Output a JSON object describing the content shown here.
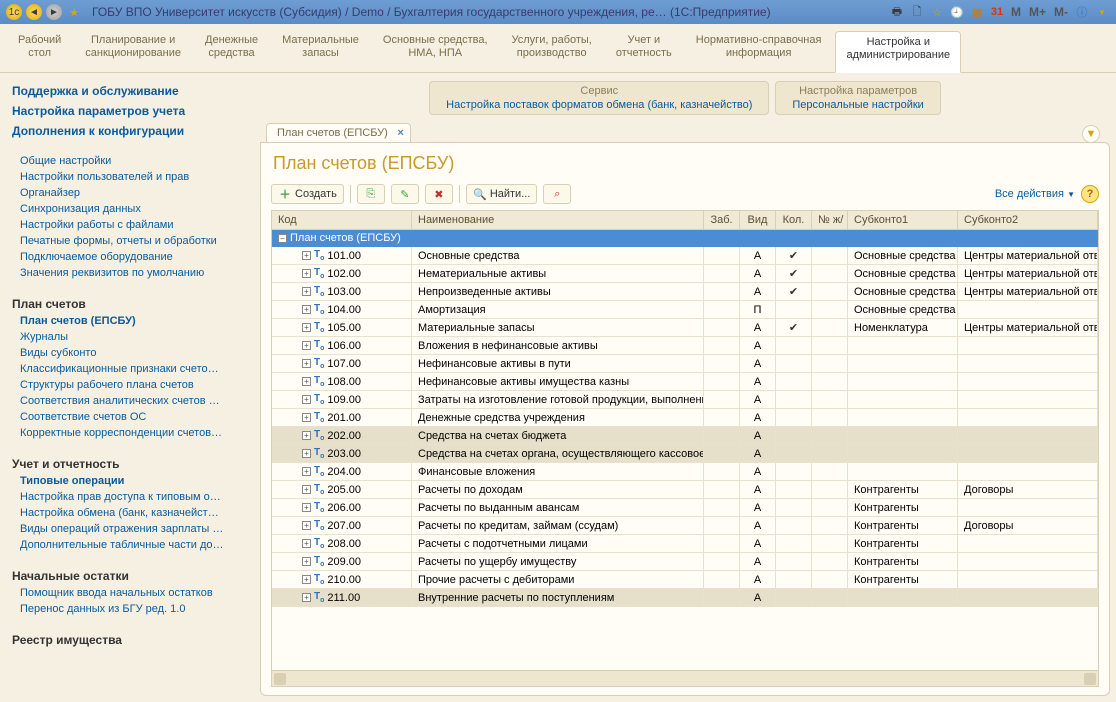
{
  "titlebar": {
    "title": "ГОБУ ВПО Университет искусств (Субсидия) / Demo / Бухгалтерия государственного учреждения, ре…   (1С:Предприятие)",
    "m_buttons": [
      "М",
      "М+",
      "М-"
    ]
  },
  "topnav": [
    {
      "l1": "Рабочий",
      "l2": "стол"
    },
    {
      "l1": "Планирование и",
      "l2": "санкционирование"
    },
    {
      "l1": "Денежные",
      "l2": "средства"
    },
    {
      "l1": "Материальные",
      "l2": "запасы"
    },
    {
      "l1": "Основные средства,",
      "l2": "НМА, НПА"
    },
    {
      "l1": "Услуги, работы,",
      "l2": "производство"
    },
    {
      "l1": "Учет и",
      "l2": "отчетность"
    },
    {
      "l1": "Нормативно-справочная",
      "l2": "информация"
    },
    {
      "l1": "Настройка и",
      "l2": "администрирование",
      "active": true
    }
  ],
  "sidebar": {
    "top": [
      "Поддержка и обслуживание",
      "Настройка параметров учета",
      "Дополнения к конфигурации"
    ],
    "general": [
      "Общие настройки",
      "Настройки пользователей и прав",
      "Органайзер",
      "Синхронизация данных",
      "Настройки работы с файлами",
      "Печатные формы, отчеты и обработки",
      "Подключаемое оборудование",
      "Значения реквизитов по умолчанию"
    ],
    "sec_plan": "План счетов",
    "plan": [
      "План счетов (ЕПСБУ)",
      "Журналы",
      "Виды субконто",
      "Классификационные признаки счето…",
      "Структуры рабочего плана счетов",
      "Соответствия аналитических счетов …",
      "Соответствие счетов ОС",
      "Корректные корреспонденции счетов…"
    ],
    "sec_uchet": "Учет и отчетность",
    "uchet": [
      "Типовые операции",
      "Настройка прав доступа к типовым о…",
      "Настройка обмена (банк, казначейст…",
      "Виды операций отражения зарплаты …",
      "Дополнительные табличные части до…"
    ],
    "sec_nach": "Начальные остатки",
    "nach": [
      "Помощник ввода начальных остатков",
      "Перенос данных из БГУ ред. 1.0"
    ],
    "sec_reestr": "Реестр имущества"
  },
  "service": {
    "h1": "Сервис",
    "l1": "Настройка поставок форматов обмена (банк, казначейство)",
    "h2": "Настройка параметров",
    "l2": "Персональные настройки"
  },
  "tab": {
    "label": "План счетов (ЕПСБУ)"
  },
  "page": {
    "title": "План счетов (ЕПСБУ)"
  },
  "toolbar": {
    "create": "Создать",
    "find": "Найти...",
    "actions": "Все действия"
  },
  "columns": {
    "code": "Код",
    "name": "Наименование",
    "zab": "Заб.",
    "vid": "Вид",
    "kol": "Кол.",
    "nzh": "№ ж/",
    "s1": "Субконто1",
    "s2": "Субконто2"
  },
  "group_row": "План счетов (ЕПСБУ)",
  "rows": [
    {
      "code": "101.00",
      "name": "Основные средства",
      "vid": "А",
      "kol": "✔",
      "s1": "Основные средства",
      "s2": "Центры материальной отве"
    },
    {
      "code": "102.00",
      "name": "Нематериальные активы",
      "vid": "А",
      "kol": "✔",
      "s1": "Основные средства",
      "s2": "Центры материальной отве"
    },
    {
      "code": "103.00",
      "name": "Непроизведенные активы",
      "vid": "А",
      "kol": "✔",
      "s1": "Основные средства",
      "s2": "Центры материальной отве"
    },
    {
      "code": "104.00",
      "name": "Амортизация",
      "vid": "П",
      "s1": "Основные средства"
    },
    {
      "code": "105.00",
      "name": "Материальные запасы",
      "vid": "А",
      "kol": "✔",
      "s1": "Номенклатура",
      "s2": "Центры материальной отве"
    },
    {
      "code": "106.00",
      "name": "Вложения в нефинансовые активы",
      "vid": "А"
    },
    {
      "code": "107.00",
      "name": "Нефинансовые активы в пути",
      "vid": "А"
    },
    {
      "code": "108.00",
      "name": "Нефинансовые активы имущества казны",
      "vid": "А"
    },
    {
      "code": "109.00",
      "name": "Затраты на изготовление готовой продукции, выполнение работ, услуг",
      "vid": "А"
    },
    {
      "code": "201.00",
      "name": "Денежные средства учреждения",
      "vid": "А"
    },
    {
      "code": "202.00",
      "name": "Средства на счетах бюджета",
      "vid": "А",
      "shade": true
    },
    {
      "code": "203.00",
      "name": "Средства на счетах органа, осуществляющего кассовое обслуживание",
      "vid": "А",
      "shade": true
    },
    {
      "code": "204.00",
      "name": "Финансовые вложения",
      "vid": "А"
    },
    {
      "code": "205.00",
      "name": "Расчеты по доходам",
      "vid": "А",
      "s1": "Контрагенты",
      "s2": "Договоры"
    },
    {
      "code": "206.00",
      "name": "Расчеты по выданным авансам",
      "vid": "А",
      "s1": "Контрагенты"
    },
    {
      "code": "207.00",
      "name": "Расчеты по кредитам, займам (ссудам)",
      "vid": "А",
      "s1": "Контрагенты",
      "s2": "Договоры"
    },
    {
      "code": "208.00",
      "name": "Расчеты с подотчетными лицами",
      "vid": "А",
      "s1": "Контрагенты"
    },
    {
      "code": "209.00",
      "name": "Расчеты по ущербу имуществу",
      "vid": "А",
      "s1": "Контрагенты"
    },
    {
      "code": "210.00",
      "name": "Прочие расчеты с дебиторами",
      "vid": "А",
      "s1": "Контрагенты"
    },
    {
      "code": "211.00",
      "name": "Внутренние расчеты по поступлениям",
      "vid": "А",
      "shade": true
    }
  ]
}
